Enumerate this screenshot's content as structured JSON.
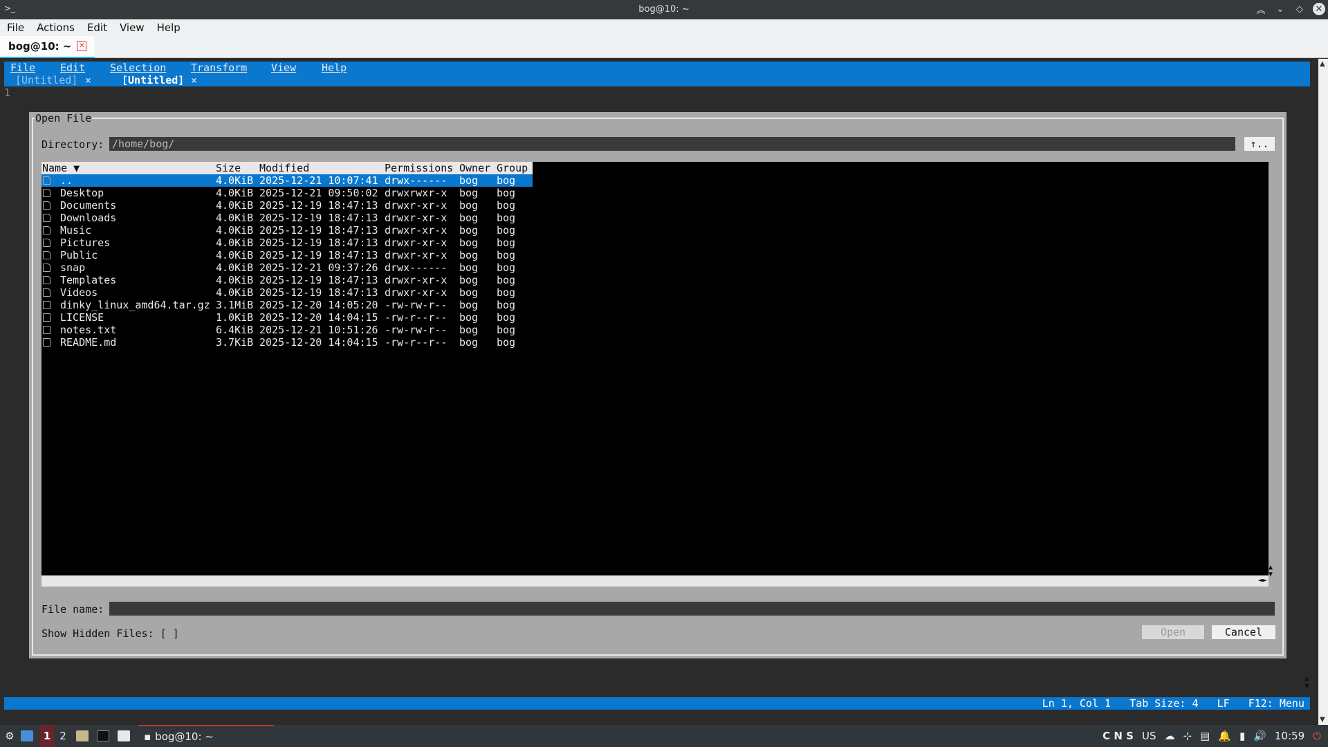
{
  "window": {
    "title": "bog@10: ~"
  },
  "terminal_menu": [
    "File",
    "Actions",
    "Edit",
    "View",
    "Help"
  ],
  "terminal_tab": {
    "label": "bog@10: ~"
  },
  "editor": {
    "menu": [
      "File",
      "Edit",
      "Selection",
      "Transform",
      "View",
      "Help"
    ],
    "tabs": [
      {
        "label": "[Untitled]",
        "close": "×"
      },
      {
        "label": "[Untitled]",
        "close": "×"
      }
    ],
    "line_number": "1"
  },
  "dialog": {
    "title": "Open File",
    "directory_label": "Directory:",
    "directory_value": "/home/bog/",
    "up_button": "↑..",
    "columns": [
      "Name ▼",
      "Size",
      "Modified",
      "Permissions",
      "Owner",
      "Group"
    ],
    "files": [
      {
        "name": "..",
        "size": "4.0KiB",
        "modified": "2025-12-21 10:07:41",
        "perms": "drwx------",
        "owner": "bog",
        "group": "bog",
        "type": "dir",
        "selected": true
      },
      {
        "name": "Desktop",
        "size": "4.0KiB",
        "modified": "2025-12-21 09:50:02",
        "perms": "drwxrwxr-x",
        "owner": "bog",
        "group": "bog",
        "type": "dir"
      },
      {
        "name": "Documents",
        "size": "4.0KiB",
        "modified": "2025-12-19 18:47:13",
        "perms": "drwxr-xr-x",
        "owner": "bog",
        "group": "bog",
        "type": "dir"
      },
      {
        "name": "Downloads",
        "size": "4.0KiB",
        "modified": "2025-12-19 18:47:13",
        "perms": "drwxr-xr-x",
        "owner": "bog",
        "group": "bog",
        "type": "dir"
      },
      {
        "name": "Music",
        "size": "4.0KiB",
        "modified": "2025-12-19 18:47:13",
        "perms": "drwxr-xr-x",
        "owner": "bog",
        "group": "bog",
        "type": "dir"
      },
      {
        "name": "Pictures",
        "size": "4.0KiB",
        "modified": "2025-12-19 18:47:13",
        "perms": "drwxr-xr-x",
        "owner": "bog",
        "group": "bog",
        "type": "dir"
      },
      {
        "name": "Public",
        "size": "4.0KiB",
        "modified": "2025-12-19 18:47:13",
        "perms": "drwxr-xr-x",
        "owner": "bog",
        "group": "bog",
        "type": "dir"
      },
      {
        "name": "snap",
        "size": "4.0KiB",
        "modified": "2025-12-21 09:37:26",
        "perms": "drwx------",
        "owner": "bog",
        "group": "bog",
        "type": "dir"
      },
      {
        "name": "Templates",
        "size": "4.0KiB",
        "modified": "2025-12-19 18:47:13",
        "perms": "drwxr-xr-x",
        "owner": "bog",
        "group": "bog",
        "type": "dir"
      },
      {
        "name": "Videos",
        "size": "4.0KiB",
        "modified": "2025-12-19 18:47:13",
        "perms": "drwxr-xr-x",
        "owner": "bog",
        "group": "bog",
        "type": "dir"
      },
      {
        "name": "dinky_linux_amd64.tar.gz",
        "size": "3.1MiB",
        "modified": "2025-12-20 14:05:20",
        "perms": "-rw-rw-r--",
        "owner": "bog",
        "group": "bog",
        "type": "file"
      },
      {
        "name": "LICENSE",
        "size": "1.0KiB",
        "modified": "2025-12-20 14:04:15",
        "perms": "-rw-r--r--",
        "owner": "bog",
        "group": "bog",
        "type": "file"
      },
      {
        "name": "notes.txt",
        "size": "6.4KiB",
        "modified": "2025-12-21 10:51:26",
        "perms": "-rw-rw-r--",
        "owner": "bog",
        "group": "bog",
        "type": "file"
      },
      {
        "name": "README.md",
        "size": "3.7KiB",
        "modified": "2025-12-20 14:04:15",
        "perms": "-rw-r--r--",
        "owner": "bog",
        "group": "bog",
        "type": "file"
      }
    ],
    "file_name_label": "File name:",
    "file_name_value": "",
    "hidden_label": "Show Hidden Files: [ ]",
    "open_button": "Open",
    "cancel_button": "Cancel"
  },
  "status": {
    "text": "Ln 1, Col 1   Tab Size: 4   LF   F12: Menu"
  },
  "taskbar": {
    "workspaces": [
      "1",
      "2"
    ],
    "window_label": "bog@10: ~",
    "tray_text": "C N S",
    "keyboard": "US",
    "clock": "10:59"
  }
}
